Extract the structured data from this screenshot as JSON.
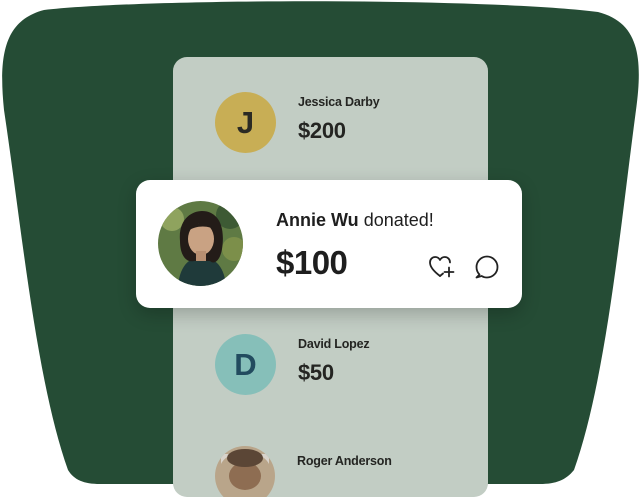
{
  "colors": {
    "background_shape": "#254c35",
    "panel": "#c2cdc4",
    "avatar_j": "#c8ae55",
    "avatar_d": "#86bfb9",
    "avatar_d_text": "#224b5f",
    "card": "#ffffff"
  },
  "feed": [
    {
      "initial": "J",
      "name": "Jessica Darby",
      "amount": "$200"
    },
    {
      "initial": "D",
      "name": "David Lopez",
      "amount": "$50"
    },
    {
      "initial": "",
      "name": "Roger Anderson",
      "amount": ""
    }
  ],
  "highlight": {
    "name": "Annie Wu",
    "action": "donated!",
    "amount": "$100",
    "icons": [
      "heart-plus-icon",
      "comment-icon"
    ]
  }
}
